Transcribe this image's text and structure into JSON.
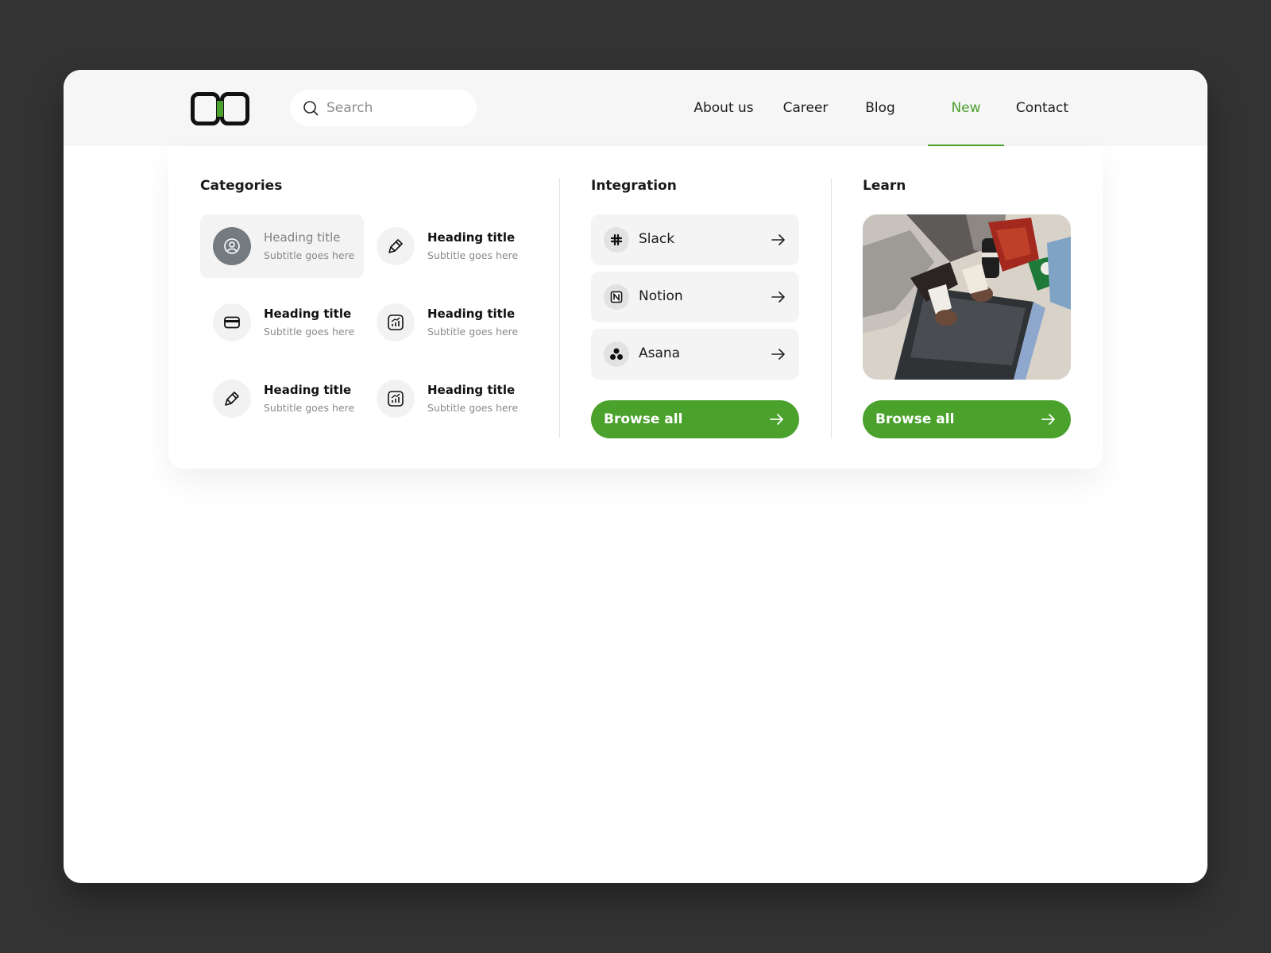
{
  "search": {
    "placeholder": "Search"
  },
  "nav": {
    "items": [
      {
        "label": "About us"
      },
      {
        "label": "Career"
      },
      {
        "label": "Blog"
      },
      {
        "label": "New",
        "active": true
      },
      {
        "label": "Contact"
      }
    ]
  },
  "categories": {
    "title": "Categories",
    "items": [
      {
        "heading": "Heading title",
        "subtitle": "Subtitle goes here",
        "icon": "user-circle-icon",
        "selected": true
      },
      {
        "heading": "Heading title",
        "subtitle": "Subtitle goes here",
        "icon": "brush-icon"
      },
      {
        "heading": "Heading title",
        "subtitle": "Subtitle goes here",
        "icon": "credit-card-icon"
      },
      {
        "heading": "Heading title",
        "subtitle": "Subtitle goes here",
        "icon": "chart-icon"
      },
      {
        "heading": "Heading title",
        "subtitle": "Subtitle goes here",
        "icon": "brush-icon"
      },
      {
        "heading": "Heading title",
        "subtitle": "Subtitle goes here",
        "icon": "chart-icon"
      }
    ]
  },
  "integration": {
    "title": "Integration",
    "items": [
      {
        "label": "Slack",
        "icon": "slack-icon"
      },
      {
        "label": "Notion",
        "icon": "notion-icon"
      },
      {
        "label": "Asana",
        "icon": "asana-icon"
      }
    ],
    "browse_label": "Browse all"
  },
  "learn": {
    "title": "Learn",
    "browse_label": "Browse all"
  },
  "colors": {
    "accent": "#4aa12c",
    "background": "#333333",
    "topbar": "#f6f6f6"
  }
}
